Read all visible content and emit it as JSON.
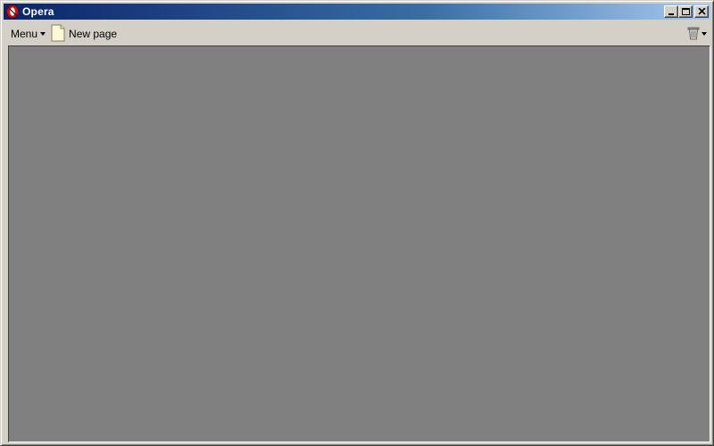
{
  "window": {
    "title": "Opera"
  },
  "titlebar": {
    "app_icon": "opera-logo-icon",
    "buttons": [
      "minimize-icon",
      "maximize-icon",
      "close-icon"
    ]
  },
  "toolbar": {
    "menu_label": "Menu",
    "new_page_label": "New page",
    "new_page_icon": "new-page-icon",
    "trash_icon": "trash-icon"
  },
  "colors": {
    "titlebar_start": "#0a246a",
    "titlebar_end": "#a6caf0",
    "workspace": "#808080",
    "chrome": "#d4d0c8"
  }
}
